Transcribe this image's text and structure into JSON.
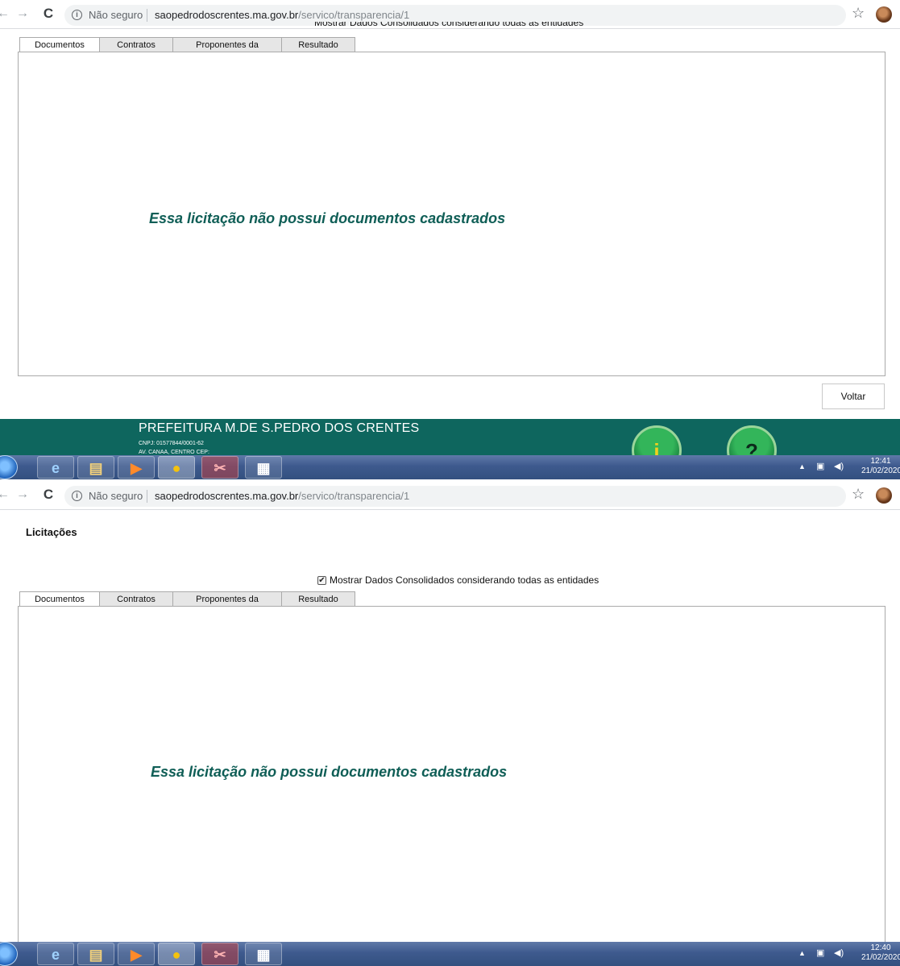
{
  "browser": {
    "security_label": "Não seguro",
    "url_host": "saopedrodoscrentes.ma.gov.br",
    "url_path": "/servico/transparencia/1"
  },
  "page": {
    "title": "Licitações",
    "consolidated_label": "Mostrar Dados Consolidados considerando todas as entidades",
    "consolidated_checked": true,
    "tabs": [
      "Documentos",
      "Contratos",
      "Proponentes da Licitação",
      "Resultado"
    ],
    "active_tab": "Documentos",
    "empty_message": "Essa licitação não possui documentos cadastrados",
    "back_button": "Voltar"
  },
  "footer": {
    "name": "PREFEITURA M.DE S.PEDRO DOS CRENTES",
    "cnpj": "CNPJ: 01577844/0001-62",
    "address": "AV. CANAA, CENTRO CEP:"
  },
  "taskbar": {
    "shot1": {
      "time": "12:41",
      "date": "21/02/2020"
    },
    "shot2": {
      "time": "12:40",
      "date": "21/02/2020"
    }
  },
  "colors": {
    "accent_green": "#0f5e56",
    "footer_bg": "#0e665e",
    "taskbar": "#3e5a8e"
  }
}
